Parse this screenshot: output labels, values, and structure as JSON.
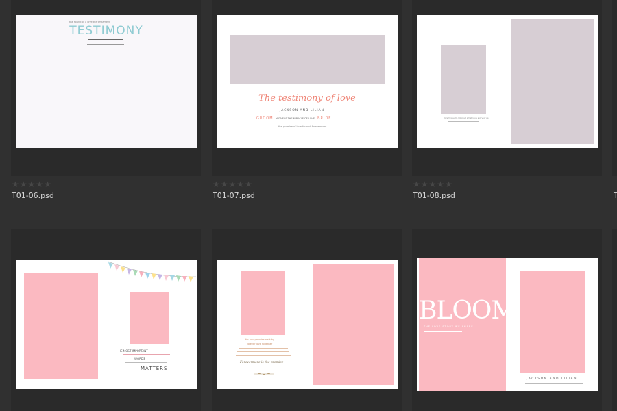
{
  "files": [
    {
      "name": "T01-06.psd",
      "rating": 0
    },
    {
      "name": "T01-07.psd",
      "rating": 0
    },
    {
      "name": "T01-08.psd",
      "rating": 0
    }
  ],
  "star_glyph": "★",
  "partial_name": "T",
  "t06": {
    "heading": "TESTIMONY",
    "top_line": "the sound of a love the testament"
  },
  "t07": {
    "script_title": "The testimony of love",
    "names": "JACKSON AND LILIAN",
    "groom": "GROOM",
    "bride": "BRIDE",
    "middle": "WITNESS THE MIRACLE OF LOVE",
    "footer": "the promise of love for rest forevermore"
  },
  "t08": {
    "caption": "lorem ipsum dolor sit amet love story of us"
  },
  "row2_a": {
    "title_part": "HE MOST IMPORTANT",
    "matters": "MATTERS",
    "words": "WORDS"
  },
  "row2_b": {
    "script": "Forevermore is the promise",
    "text1": "for you promise walk by",
    "text2": "forever love together"
  },
  "row2_c": {
    "heading": "BLOOM",
    "sub": "THE LOVE STORY WE SHARE",
    "names": "JACKSON AND LILIAN"
  },
  "colors": {
    "teal": "#8fcbd2",
    "coral": "#ef8577",
    "placeholder_gray": "#d7ced4",
    "placeholder_pink": "#fbb9c1"
  }
}
